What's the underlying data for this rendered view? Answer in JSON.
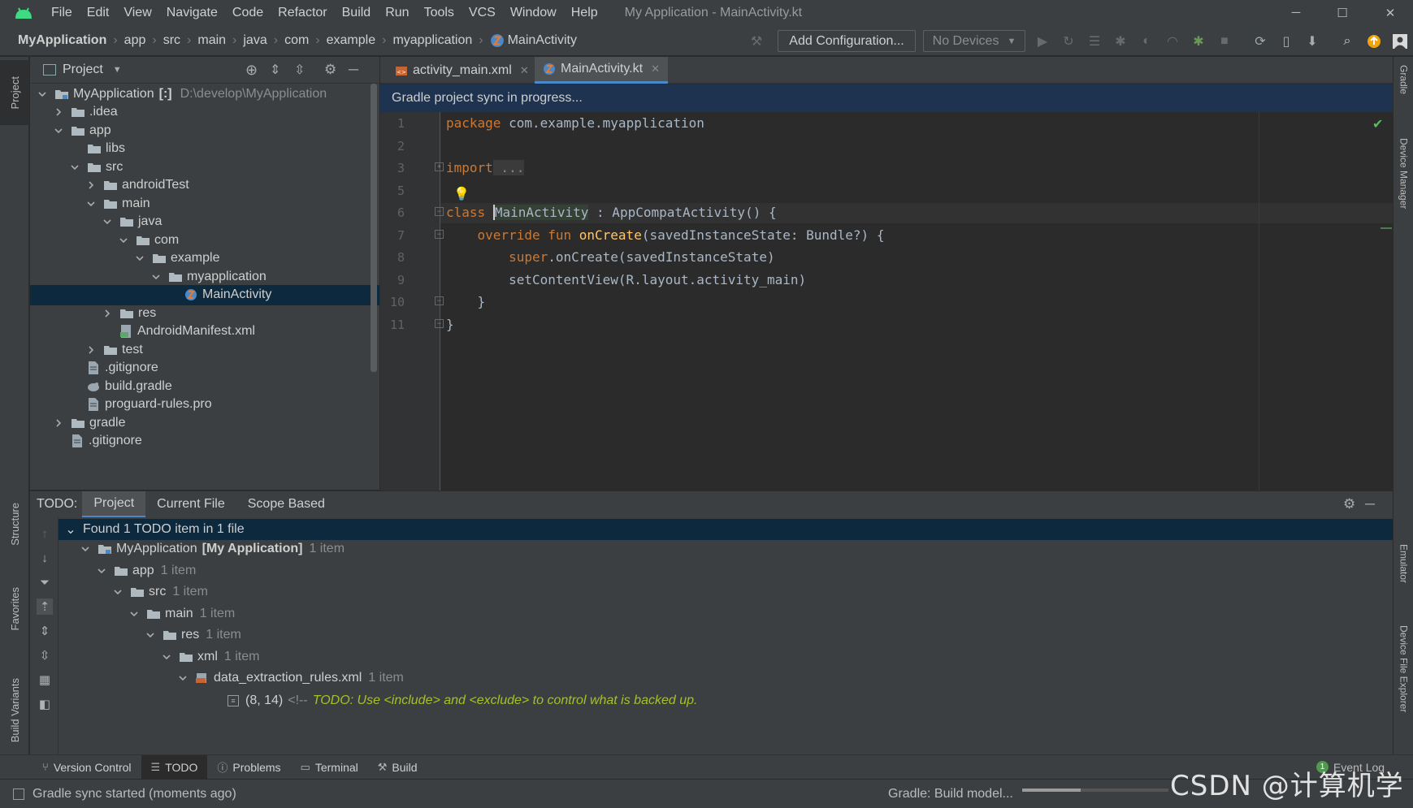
{
  "window": {
    "title": "My Application - MainActivity.kt",
    "menu": [
      "File",
      "Edit",
      "View",
      "Navigate",
      "Code",
      "Refactor",
      "Build",
      "Run",
      "Tools",
      "VCS",
      "Window",
      "Help"
    ],
    "controls": [
      "minimize-icon",
      "maximize-icon",
      "close-icon"
    ]
  },
  "breadcrumb": [
    "MyApplication",
    "app",
    "src",
    "main",
    "java",
    "com",
    "example",
    "myapplication",
    "MainActivity"
  ],
  "toolbar": {
    "add_config": "Add Configuration...",
    "devices": "No Devices"
  },
  "project": {
    "title": "Project",
    "tree": [
      {
        "label": "MyApplication",
        "suffix": "[:]",
        "path": "D:\\develop\\MyApplication",
        "depth": 0,
        "type": "module",
        "open": true
      },
      {
        "label": ".idea",
        "depth": 1,
        "type": "folder",
        "open": false
      },
      {
        "label": "app",
        "depth": 1,
        "type": "folder",
        "open": true
      },
      {
        "label": "libs",
        "depth": 2,
        "type": "folder",
        "leaf": true
      },
      {
        "label": "src",
        "depth": 2,
        "type": "folder",
        "open": true
      },
      {
        "label": "androidTest",
        "depth": 3,
        "type": "folder",
        "open": false
      },
      {
        "label": "main",
        "depth": 3,
        "type": "folder",
        "open": true
      },
      {
        "label": "java",
        "depth": 4,
        "type": "folder",
        "open": true
      },
      {
        "label": "com",
        "depth": 5,
        "type": "folder",
        "open": true
      },
      {
        "label": "example",
        "depth": 6,
        "type": "folder",
        "open": true
      },
      {
        "label": "myapplication",
        "depth": 7,
        "type": "folder",
        "open": true
      },
      {
        "label": "MainActivity",
        "depth": 8,
        "type": "kotlin",
        "selected": true
      },
      {
        "label": "res",
        "depth": 4,
        "type": "folder",
        "open": false
      },
      {
        "label": "AndroidManifest.xml",
        "depth": 4,
        "type": "manifest",
        "leaf": true
      },
      {
        "label": "test",
        "depth": 3,
        "type": "folder",
        "open": false
      },
      {
        "label": ".gitignore",
        "depth": 2,
        "type": "file",
        "leaf": true
      },
      {
        "label": "build.gradle",
        "depth": 2,
        "type": "gradle",
        "leaf": true
      },
      {
        "label": "proguard-rules.pro",
        "depth": 2,
        "type": "file",
        "leaf": true
      },
      {
        "label": "gradle",
        "depth": 1,
        "type": "folder",
        "open": false
      },
      {
        "label": ".gitignore",
        "depth": 1,
        "type": "file",
        "leaf": true
      }
    ]
  },
  "editor": {
    "tabs": [
      {
        "label": "activity_main.xml",
        "active": false
      },
      {
        "label": "MainActivity.kt",
        "active": true
      }
    ],
    "sync_banner": "Gradle project sync in progress...",
    "line_numbers": [
      "1",
      "2",
      "3",
      "5",
      "6",
      "7",
      "8",
      "9",
      "10",
      "11"
    ],
    "code": {
      "l1_kw": "package",
      "l1_rest": " com.example.myapplication",
      "l3_kw": "import",
      "l3_rest": " ...",
      "l6_kw": "class",
      "l6_name": "MainActivity",
      "l6_rest": " : AppCompatActivity() {",
      "l7_kw": "    override fun",
      "l7_fn": " onCreate",
      "l7_rest": "(savedInstanceState: Bundle?) {",
      "l8_kw": "        super",
      "l8_rest": ".onCreate(savedInstanceState)",
      "l9": "        setContentView(R.layout.activity_main)",
      "l10": "    }",
      "l11": "}"
    }
  },
  "todo": {
    "label": "TODO:",
    "tabs": [
      "Project",
      "Current File",
      "Scope Based"
    ],
    "summary": "Found 1 TODO item in 1 file",
    "rows": [
      {
        "label": "MyApplication",
        "bold": "[My Application]",
        "count": "1 item",
        "depth": 1
      },
      {
        "label": "app",
        "count": "1 item",
        "depth": 2
      },
      {
        "label": "src",
        "count": "1 item",
        "depth": 3
      },
      {
        "label": "main",
        "count": "1 item",
        "depth": 4
      },
      {
        "label": "res",
        "count": "1 item",
        "depth": 5
      },
      {
        "label": "xml",
        "count": "1 item",
        "depth": 6
      },
      {
        "label": "data_extraction_rules.xml",
        "count": "1 item",
        "depth": 7
      }
    ],
    "item": {
      "pos": "(8, 14)",
      "prefix": "<!--",
      "text": "TODO: Use <include> and <exclude> to control what is backed up."
    }
  },
  "left_strip": [
    "Project",
    "Structure",
    "Favorites",
    "Build Variants"
  ],
  "right_strip": [
    "Gradle",
    "Device Manager",
    "Emulator",
    "Device File Explorer"
  ],
  "bottom_tools": [
    {
      "label": "Version Control",
      "icon": "branch-icon",
      "active": false
    },
    {
      "label": "TODO",
      "icon": "list-icon",
      "active": true
    },
    {
      "label": "Problems",
      "icon": "info-icon",
      "active": false
    },
    {
      "label": "Terminal",
      "icon": "terminal-icon",
      "active": false
    },
    {
      "label": "Build",
      "icon": "hammer-icon",
      "active": false
    }
  ],
  "event_log": {
    "label": "Event Log",
    "badge": "1"
  },
  "status": {
    "message": "Gradle sync started (moments ago)",
    "task": "Gradle: Build model..."
  },
  "watermark": "CSDN @计算机学长",
  "colors": {
    "accent": "#4a88c7",
    "keyword": "#cc7832",
    "function": "#ffc66d",
    "todo": "#a8c023",
    "banner": "#1e3350"
  }
}
